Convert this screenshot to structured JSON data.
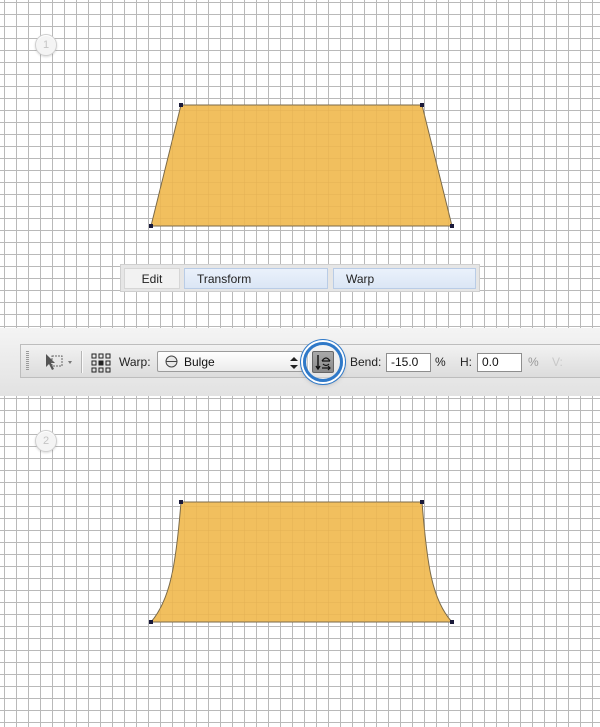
{
  "steps": {
    "step1": "1",
    "step2": "2"
  },
  "menu": {
    "edit": "Edit",
    "transform": "Transform",
    "warp": "Warp"
  },
  "toolbar": {
    "warp_label": "Warp:",
    "warp_style": "Bulge",
    "bend_label": "Bend:",
    "bend_value": "-15.0",
    "bend_unit": "%",
    "h_label": "H:",
    "h_value": "0.0",
    "h_unit": "%",
    "v_label": "V:"
  },
  "icons": {
    "point_transform": "transform-point-icon",
    "reference_grid": "reference-grid-icon",
    "warp_style": "bulge-style-icon",
    "select_arrows": "up-down-arrows-icon",
    "change_orientation": "change-warp-orientation-icon"
  },
  "colors": {
    "shape_fill": "#f1bf5e",
    "shape_stroke": "#7a6a4a",
    "anchor": "#1a1a3a",
    "highlight": "#2f79c8"
  }
}
